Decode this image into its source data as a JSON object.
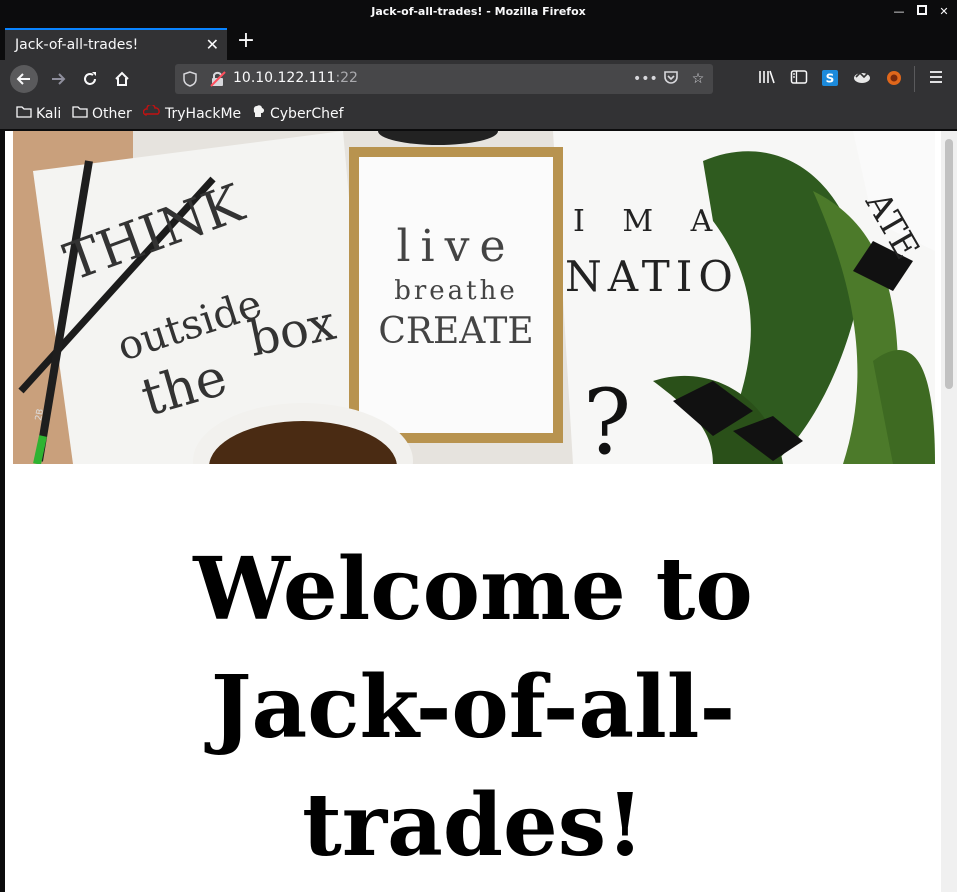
{
  "window": {
    "title": "Jack-of-all-trades! - Mozilla Firefox"
  },
  "tabs": [
    {
      "label": "Jack-of-all-trades!"
    }
  ],
  "urlbar": {
    "host": "10.10.122.111",
    "port": ":22"
  },
  "bookmarks": [
    {
      "label": "Kali",
      "icon": "folder-icon"
    },
    {
      "label": "Other",
      "icon": "folder-icon"
    },
    {
      "label": "TryHackMe",
      "icon": "tryhackme-icon"
    },
    {
      "label": "CyberChef",
      "icon": "cyberchef-icon"
    }
  ],
  "hero_image": {
    "think": "THINK",
    "outside": "outside",
    "the": "the",
    "box": "box",
    "live": "live",
    "breathe": "breathe",
    "create": "CREATE",
    "ima": "I M A",
    "natio": "NATIO",
    "qmark": "?",
    "corner": "ATE",
    "pencil_mark": "2B"
  },
  "page": {
    "heading_line1": "Welcome to",
    "heading_line2": "Jack-of-all-",
    "heading_line3": "trades!"
  },
  "colors": {
    "accent": "#0a84ff",
    "toolbar": "#323234",
    "frame": "#0c0c0d"
  }
}
